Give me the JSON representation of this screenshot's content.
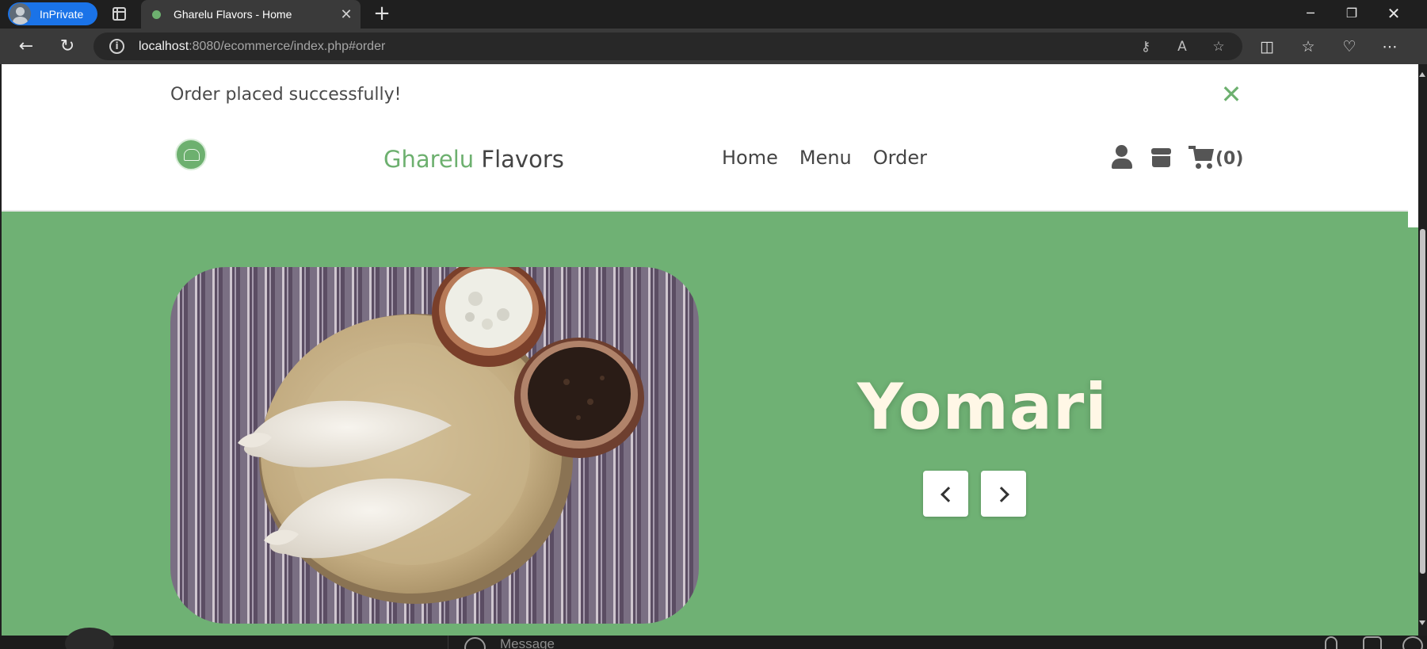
{
  "browser": {
    "inprivate_label": "InPrivate",
    "tab_title": "Gharelu Flavors - Home",
    "url_host": "localhost",
    "url_path": ":8080/ecommerce/index.php#order"
  },
  "alert": {
    "message": "Order placed successfully!",
    "close_glyph": "✕"
  },
  "header": {
    "brand_part1": "Gharelu",
    "brand_part2": "Flavors",
    "nav": [
      "Home",
      "Menu",
      "Order"
    ],
    "cart_count": "(0)"
  },
  "hero": {
    "title": "Yomari",
    "image_subject": "yomari-dumplings-plate"
  },
  "messaging": {
    "placeholder": "Message"
  },
  "colors": {
    "accent": "#6db06f",
    "hero_bg": "#6fb174",
    "hero_title": "#fff7e6",
    "browser_bg": "#1f1f1f",
    "toolbar_bg": "#3a3a3a",
    "inprivate_badge": "#1a73e8"
  }
}
